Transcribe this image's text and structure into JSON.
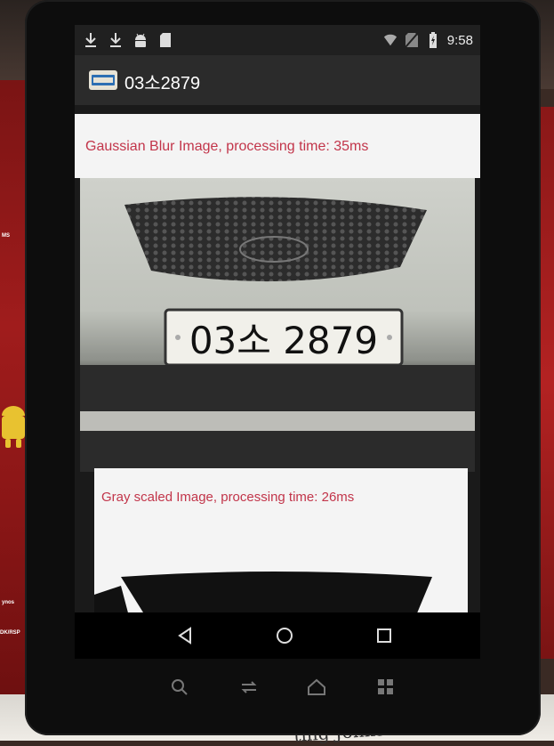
{
  "status_bar": {
    "time": "9:58",
    "left_icons": [
      "download-icon",
      "download-icon",
      "android-icon",
      "sd-card-icon"
    ],
    "right_icons": [
      "wifi-icon",
      "no-sim-icon",
      "battery-charging-icon"
    ]
  },
  "app_bar": {
    "title": "03소2879",
    "icon": "license-plate-icon"
  },
  "panels": {
    "gaussian_caption": "Gaussian Blur Image, processing time: 35ms",
    "gray_caption": "Gray scaled Image, processing time: 26ms"
  },
  "photo": {
    "plate_text": "03소 2879",
    "car_badge": "KIA"
  },
  "nav_bar": {
    "buttons": [
      "back-icon",
      "home-icon",
      "recents-icon"
    ]
  },
  "hardware_buttons": [
    "search-icon",
    "rotate-icon",
    "home-outline-icon",
    "grid-icon"
  ],
  "environment": {
    "background_caption": "ting Johnson Cou",
    "board_label_1": "ynos",
    "board_label_2": "DK/RSP",
    "board_label_3": "MS"
  },
  "colors": {
    "caption_red": "#c2354a",
    "status_bar": "#202020",
    "app_bar": "#2b2b2b"
  }
}
